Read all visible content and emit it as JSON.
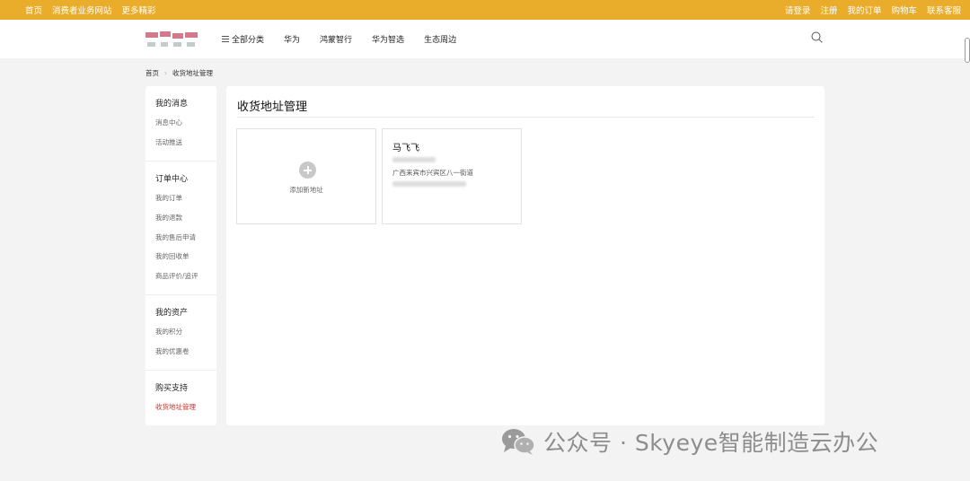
{
  "topbar": {
    "left": [
      "首页",
      "消费者业务网站",
      "更多精彩"
    ],
    "right": [
      "请登录",
      "注册",
      "我的订单",
      "购物车",
      "联系客服"
    ]
  },
  "header": {
    "nav": [
      "全部分类",
      "华为",
      "鸿蒙智行",
      "华为智选",
      "生态周边"
    ]
  },
  "breadcrumb": [
    "首页",
    "收货地址管理"
  ],
  "sidebar": {
    "groups": [
      {
        "title": "我的消息",
        "items": [
          "消息中心",
          "活动推送"
        ]
      },
      {
        "title": "订单中心",
        "items": [
          "我的订单",
          "我的退款",
          "我的售后申请",
          "我的回收单",
          "商品评价/追评"
        ]
      },
      {
        "title": "我的资产",
        "items": [
          "我的积分",
          "我的优惠卷"
        ]
      },
      {
        "title": "购买支持",
        "items": [
          "收货地址管理"
        ]
      }
    ],
    "active": "收货地址管理"
  },
  "main": {
    "title": "收货地址管理",
    "add_label": "添加新地址",
    "address": {
      "name": "马飞飞",
      "region": "广西来宾市兴宾区八一街道"
    }
  },
  "watermark": "公众号 · Skyeye智能制造云办公",
  "colors": {
    "topbar": "#e9ad2b",
    "active_link": "#d0332c"
  }
}
